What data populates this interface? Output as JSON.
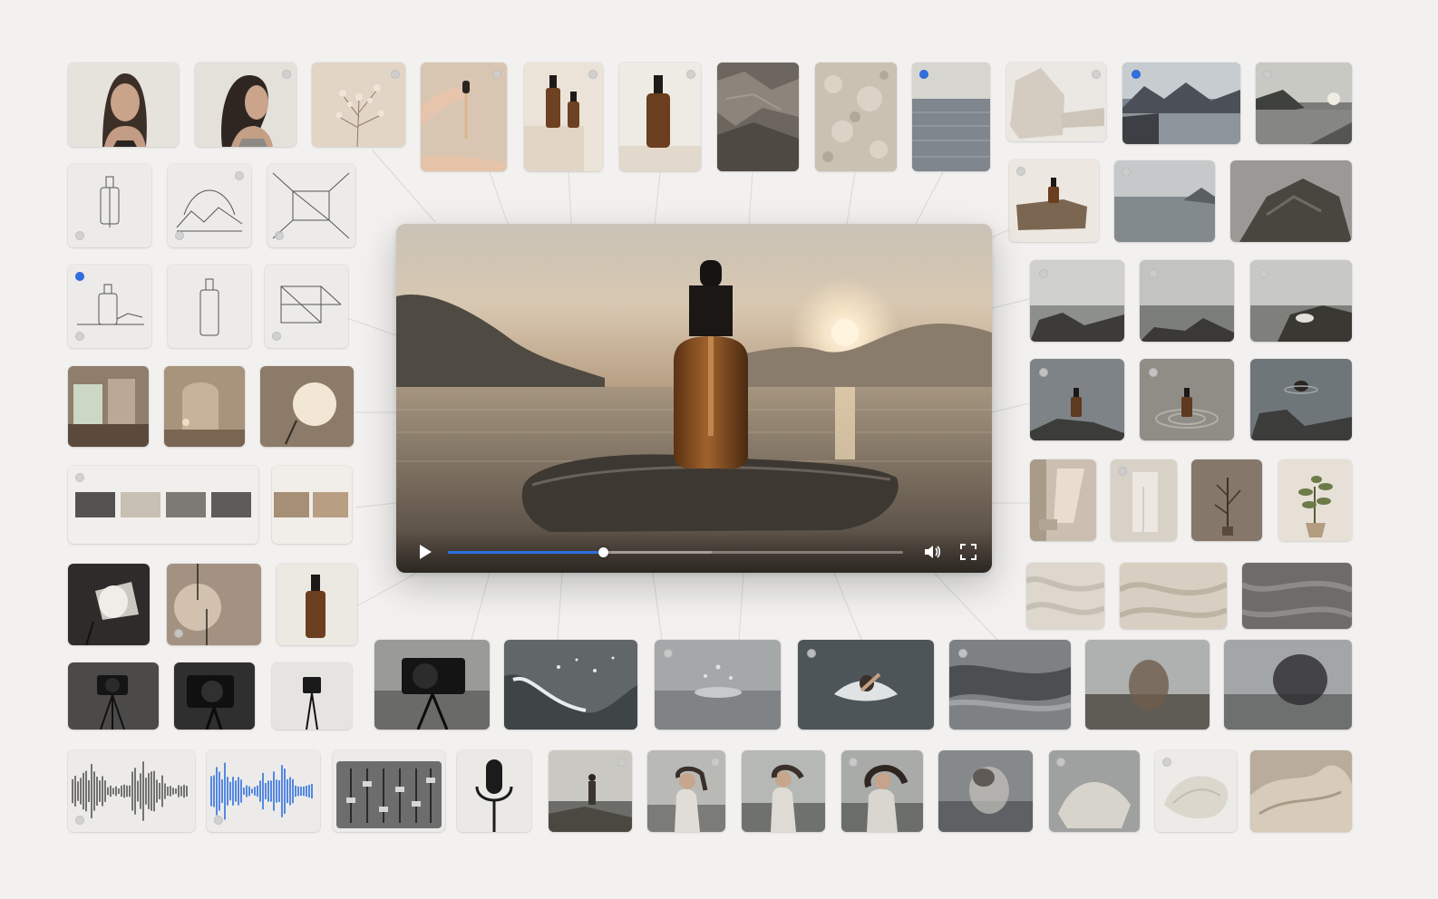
{
  "app": {
    "view": "moodboard-canvas"
  },
  "colors": {
    "background": "#f2f1ef",
    "accent": "#2f6fe0",
    "tile_dot": "#cdcdcd"
  },
  "player": {
    "state": "paused",
    "progress": 0.34,
    "buffered": 0.58,
    "icons": [
      "play-icon",
      "volume-icon",
      "fullscreen-icon"
    ]
  },
  "palette_swatches": {
    "main": [
      "#55534f",
      "#c9c0b4",
      "#7d7a76",
      "#5e5c59"
    ],
    "secondary": [
      "#a58f75",
      "#b89f83"
    ]
  },
  "selected_tiles": [
    "sketch-dropper-bottle-small",
    "seascape-calm-sea-horizon",
    "seascape-mountain-lake"
  ]
}
